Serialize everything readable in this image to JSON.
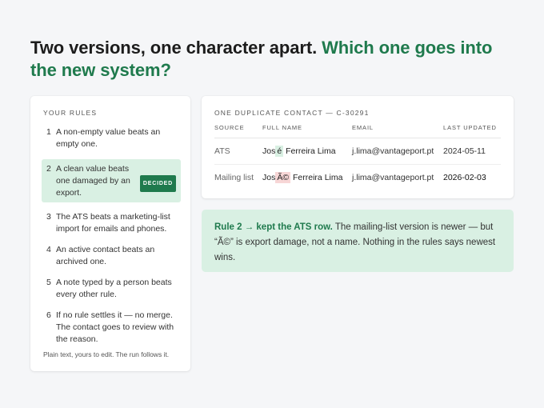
{
  "headline": {
    "part1": "Two versions, one character apart.",
    "part2": "Which one goes into the new system?"
  },
  "rules": {
    "heading": "YOUR RULES",
    "items": [
      {
        "num": "1",
        "text": "A non-empty value beats an empty one."
      },
      {
        "num": "2",
        "text": "A clean value beats one damaged by an export.",
        "badge": "DECIDED"
      },
      {
        "num": "3",
        "text": "The ATS beats a marketing-list import for emails and phones."
      },
      {
        "num": "4",
        "text": "An active contact beats an archived one."
      },
      {
        "num": "5",
        "text": "A note typed by a person beats every other rule."
      },
      {
        "num": "6",
        "text": "If no rule settles it — no merge. The contact goes to review with the reason."
      }
    ],
    "footer": "Plain text, yours to edit. The run follows it."
  },
  "contact": {
    "heading": "ONE DUPLICATE CONTACT — C-30291",
    "columns": [
      "SOURCE",
      "FULL NAME",
      "EMAIL",
      "LAST UPDATED"
    ],
    "rows": [
      {
        "source": "ATS",
        "name_pre": "Jos",
        "name_char": "é",
        "name_post": "Ferreira Lima",
        "email": "j.lima@vantageport.pt",
        "updated": "2024-05-11"
      },
      {
        "source": "Mailing list",
        "name_pre": "Jos",
        "name_char": "Ã©",
        "name_post": "Ferreira Lima",
        "email": "j.lima@vantageport.pt",
        "updated": "2026-02-03"
      }
    ]
  },
  "note": {
    "strong": "Rule 2 → kept the ATS row.",
    "body": "The mailing-list version is newer — but “Ã©” is export damage, not a name. Nothing in the rules says newest wins."
  },
  "colors": {
    "accent": "#1f7a4d",
    "accent_bg": "#d9f0e3",
    "error_bg": "#f7d6d6"
  }
}
